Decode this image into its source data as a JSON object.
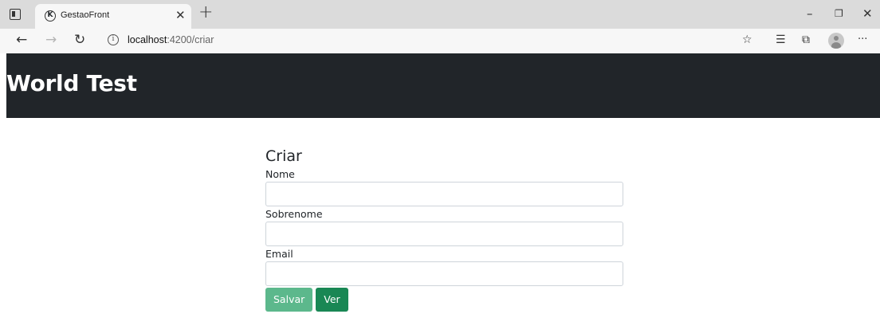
{
  "browser": {
    "tab_title": "GestaoFront",
    "favicon_letter": "K",
    "url_host": "localhost",
    "url_path": ":4200/criar",
    "icons": [
      "tab-actions-icon",
      "close-icon",
      "new-tab-icon",
      "minimize-icon",
      "restore-icon",
      "window-close-icon",
      "back-icon",
      "forward-icon",
      "refresh-icon",
      "info-icon",
      "favorite-add-icon",
      "favorites-icon",
      "collections-icon",
      "profile-icon",
      "more-icon"
    ]
  },
  "header": {
    "brand": "World Test"
  },
  "form": {
    "title": "Criar",
    "fields": [
      {
        "label": "Nome",
        "value": ""
      },
      {
        "label": "Sobrenome",
        "value": ""
      },
      {
        "label": "Email",
        "value": ""
      }
    ],
    "save_label": "Salvar",
    "view_label": "Ver"
  },
  "colors": {
    "navbar": "#212529",
    "save_button": "#5cb88c",
    "view_button": "#198754"
  }
}
